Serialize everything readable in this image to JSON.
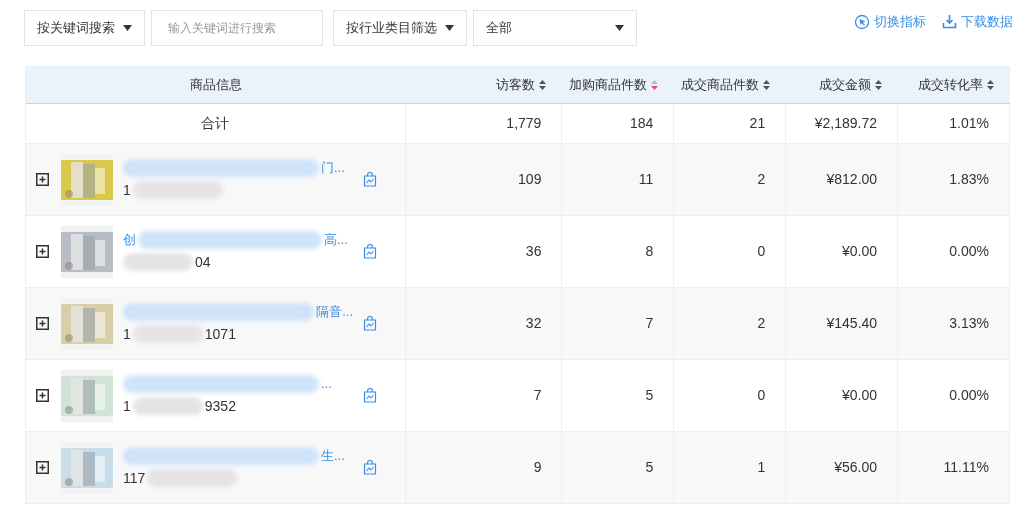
{
  "filters": [
    {
      "kind": "dropdown",
      "label": "按关键词搜索"
    },
    {
      "kind": "input",
      "placeholder": "输入关键词进行搜索"
    },
    {
      "kind": "dropdown",
      "label": "按行业类目筛选"
    },
    {
      "kind": "select",
      "value": "全部"
    }
  ],
  "actions": [
    {
      "kind": "switch",
      "label": "切换指标"
    },
    {
      "kind": "download",
      "label": "下载数据"
    }
  ],
  "table": {
    "columns": [
      {
        "label": "商品信息"
      },
      {
        "label": "访客数",
        "sorted": false
      },
      {
        "label": "加购商品件数",
        "sorted": true
      },
      {
        "label": "成交商品件数",
        "sorted": false
      },
      {
        "label": "成交金额",
        "sorted": false
      },
      {
        "label": "成交转化率",
        "sorted": false
      }
    ],
    "total": {
      "label": "合计",
      "values": [
        "1,779",
        "184",
        "21",
        "¥2,189.72",
        "1.01%"
      ]
    },
    "rows": [
      {
        "title_start": "",
        "title_end": "门...",
        "id_start": "1",
        "id_end": "",
        "values": [
          "109",
          "11",
          "2",
          "¥812.00",
          "1.83%"
        ]
      },
      {
        "title_start": "创",
        "title_end": "高...",
        "id_start": "",
        "id_end": "04",
        "values": [
          "36",
          "8",
          "0",
          "¥0.00",
          "0.00%"
        ]
      },
      {
        "title_start": "",
        "title_end": "隔音...",
        "id_start": "1",
        "id_end": "1071",
        "values": [
          "32",
          "7",
          "2",
          "¥145.40",
          "3.13%"
        ]
      },
      {
        "title_start": "",
        "title_end": "...",
        "id_start": "1",
        "id_end": "9352",
        "values": [
          "7",
          "5",
          "0",
          "¥0.00",
          "0.00%"
        ]
      },
      {
        "title_start": "",
        "title_end": "生...",
        "id_start": "117",
        "id_end": "",
        "values": [
          "9",
          "5",
          "1",
          "¥56.00",
          "11.11%"
        ]
      }
    ]
  }
}
